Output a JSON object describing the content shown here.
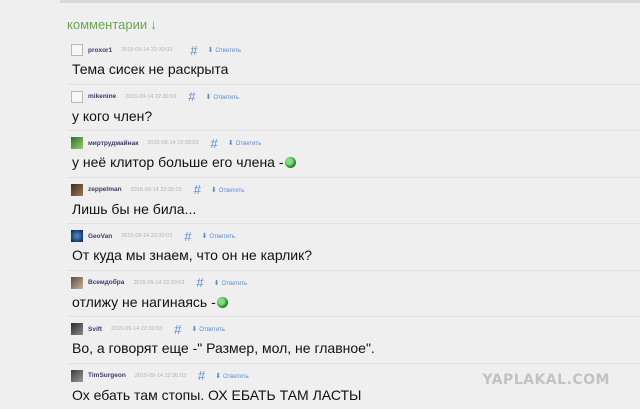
{
  "section": {
    "title": "комментарии",
    "arrow": "↓"
  },
  "comments": [
    {
      "user": "proxor1",
      "date": "2015-09-14 22:30:03",
      "hash": "#",
      "reply": "Ответить",
      "text": "Тема сисек не раскрыта",
      "smiley": false
    },
    {
      "user": "mikenine",
      "date": "2015-09-14 22:30:03",
      "hash": "#",
      "reply": "Ответить",
      "text": "у кого член?",
      "smiley": false
    },
    {
      "user": "миртрудмайнак",
      "date": "2015-09-14 22:30:03",
      "hash": "#",
      "reply": "Ответить",
      "text": "у неё клитор больше его члена -",
      "smiley": true
    },
    {
      "user": "zeppelman",
      "date": "2015-09-14 22:30:03",
      "hash": "#",
      "reply": "Ответить",
      "text": "Лишь бы не била...",
      "smiley": false
    },
    {
      "user": "GeoVan",
      "date": "2015-09-14 22:30:03",
      "hash": "#",
      "reply": "Ответить",
      "text": "От куда мы знаем, что он не карлик?",
      "smiley": false
    },
    {
      "user": "Всемдобра",
      "date": "2015-09-14 22:30:03",
      "hash": "#",
      "reply": "Ответить",
      "text": "отлижу не нагинаясь -",
      "smiley": true
    },
    {
      "user": "Svift",
      "date": "2015-09-14 22:30:03",
      "hash": "#",
      "reply": "Ответить",
      "text": "Во, а говорят еще -\" Размер, мол, не главное\".",
      "smiley": false
    },
    {
      "user": "TimSurgeon",
      "date": "2015-09-14 22:30:03",
      "hash": "#",
      "reply": "Ответить",
      "text": "Ох ебать там стопы. ОХ ЕБАТЬ ТАМ ЛАСТЫ",
      "smiley": false
    }
  ],
  "watermark": "YAPLAKAL.COM",
  "colors": {
    "link": "#5b8ed6",
    "section_title": "#6aa84f",
    "background": "#efefef"
  }
}
